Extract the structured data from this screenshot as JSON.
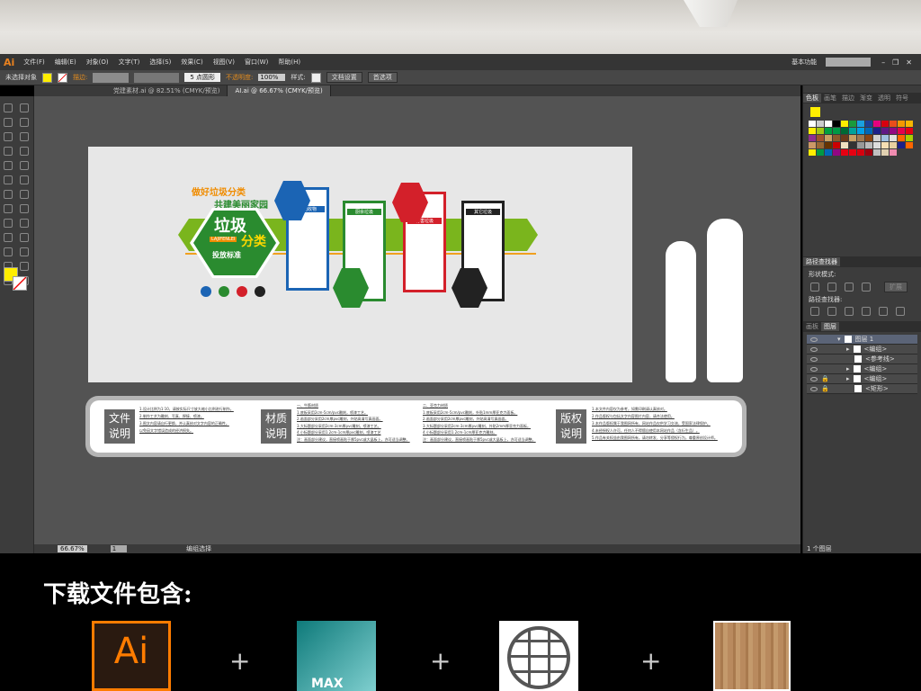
{
  "menubar": {
    "logo": "Ai",
    "items": [
      "文件(F)",
      "编辑(E)",
      "对象(O)",
      "文字(T)",
      "选择(S)",
      "效果(C)",
      "视图(V)",
      "窗口(W)",
      "帮助(H)"
    ],
    "workspace": "基本功能"
  },
  "control": {
    "selection": "未选择对象",
    "stroke_label": "描边:",
    "brush": "5 点圆形",
    "opacity_label": "不透明度:",
    "opacity": "100%",
    "style_label": "样式:",
    "doc_setup": "文档设置",
    "prefs": "首选项",
    "fill_color": "#ffee00"
  },
  "tabs": [
    "党建素材.ai @ 82.51% (CMYK/预览)",
    "AI.ai @ 66.67% (CMYK/预览)"
  ],
  "status": {
    "zoom": "66.67%",
    "page": "1",
    "tool": "编组选择"
  },
  "swatch_panel": {
    "tabs": [
      "色板",
      "画笔",
      "描边",
      "渐变",
      "透明",
      "符号"
    ],
    "colors": [
      "#ffffff",
      "#cccccc",
      "#ffffff",
      "#000000",
      "#ffee00",
      "#1a9a3c",
      "#1aa0e0",
      "#1c3f95",
      "#e4007f",
      "#d7000f",
      "#e94e1b",
      "#f39800",
      "#f8b500",
      "#ffee00",
      "#a0c814",
      "#00a040",
      "#009944",
      "#006934",
      "#00a29a",
      "#00a0e9",
      "#0068b7",
      "#1d2088",
      "#601986",
      "#920783",
      "#e5004f",
      "#e60012",
      "#8f2e8f",
      "#a0522d",
      "#c9a063",
      "#8b5a2b",
      "#6b3a1b",
      "#c8a064",
      "#a07850",
      "#8b4513",
      "#d0d0d0",
      "#9fc0e0",
      "#e0e0e0",
      "#ff6600",
      "#a8d000",
      "#cc9966",
      "#996633",
      "#663300",
      "#cc0000",
      "#f0e0c0",
      "#333333",
      "#999999",
      "#bbbbbb",
      "#dddddd",
      "#f5deb3",
      "#e8d0a0",
      "#1c2088",
      "#ff6600",
      "#ffee00",
      "#009944",
      "#0068b7",
      "#920783",
      "#e60012",
      "#e60012",
      "#d7000f",
      "#a0000f",
      "#c0c0c0",
      "#e0d0b0",
      "#f08cb0"
    ]
  },
  "pathfinder": {
    "title": "路径查找器",
    "shape_modes": "形状模式:",
    "expand": "扩展",
    "finders": "路径查找器:"
  },
  "layers": {
    "tabs": [
      "画板",
      "图层"
    ],
    "rows": [
      "图层 1",
      "<编组>",
      "<参考线>",
      "<编组>",
      "<编组>",
      "<矩形>"
    ],
    "count": "1 个图层"
  },
  "artwork": {
    "slogan1": "做好垃圾分类",
    "slogan2": "共建美丽家园",
    "main1": "垃圾",
    "main2": "分类",
    "pinyin": "LAJIFENLEI",
    "main3": "投放标准",
    "cats": [
      {
        "name": "可回收物",
        "color": "#1b64b4"
      },
      {
        "name": "厨余垃圾",
        "color": "#2a8b2f"
      },
      {
        "name": "有害垃圾",
        "color": "#d3202a"
      },
      {
        "name": "其它垃圾",
        "color": "#222222"
      }
    ]
  },
  "board": {
    "file_tag": [
      "文件",
      "说明"
    ],
    "file_lines": [
      "1.设计比例为1:10，请按实际尺寸放大缩小比例进行制作。",
      "2.制作工艺为雕刻、写真、焊接、喷漆。",
      "3.图文内容请自行更换，并认真核对文字内容的正确性。",
      "以免因文字错误造成的经济损失。"
    ],
    "mat_tag": [
      "材质",
      "说明"
    ],
    "mat_lines1": [
      "一、牛筋材质",
      "1.底板采用2cm-5cm/pvc雕刻，喷漆工艺。",
      "2.画面部分采用2cm厚pvc雕刻，外贴高清写真画面。",
      "3.大标题部分采用2cm-3cm厚pvc雕刻，喷漆工艺。",
      "4.小标题部分采用1.2cm-1cm厚pvc雕刻，喷漆工艺",
      "注：画面部分建议，直接喷画贴于厚5pvc或大晶板上，亦可适当调整。"
    ],
    "mat_lines2": [
      "二、亚克力材质",
      "1.底板采用2cm-5cm/pvc雕刻，外贴1mm厚亚克力面板。",
      "2.画面部分采用2cm厚pvc雕刻，外贴高清写真画面。",
      "3.大标题部分采用2cm-3cm厚pvc雕刻，外贴2mm厚亚克力面板。",
      "4.小标题部分采用1.2cm-1cm厚亚克力雕刻。",
      "注：画面部分建议，直接喷画贴于厚5pvc或大晶板上，亦可适当调整。"
    ],
    "copy_tag": [
      "版权",
      "说明"
    ],
    "copy_lines": [
      "1.本文件内容仅为参考，如需印刷请认真核对。",
      "2.作品版权与包括文字内容图片内容，请合法使用。",
      "3.本作品版权属于我图网所有，网站作品仅供学习交流，受国家法律保护。",
      "4.未经授权人许可，任何人不得擅自使用本网站作品（含衍生品）。",
      "5.作品有关权益由我图网所有，请勿转发、分享等侵权行为，尊重原创设计师。"
    ]
  },
  "bottom": {
    "title": "下载文件包含:",
    "icons": [
      "ai-file-icon",
      "3ds-max-icon",
      "globe-icon",
      "wood-texture-icon"
    ],
    "max_label": "MAX",
    "ai_label": "Ai",
    "plus": "+"
  }
}
